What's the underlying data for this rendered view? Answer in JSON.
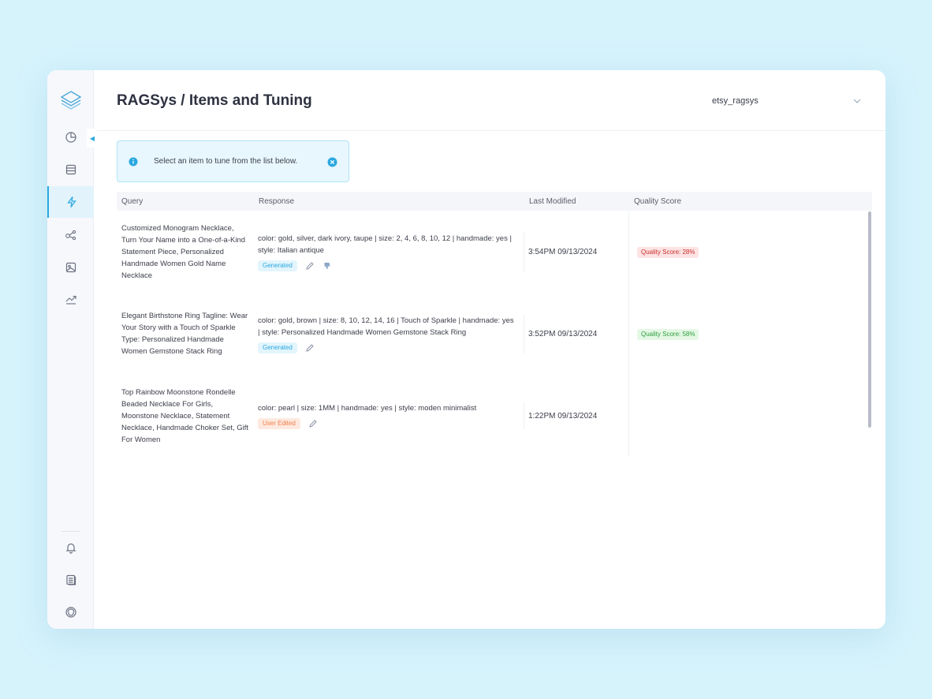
{
  "header": {
    "title": "RAGSys / Items and Tuning"
  },
  "workspace": {
    "selected": "etsy_ragsys"
  },
  "alert": {
    "text": "Select an item to tune from the list below."
  },
  "table": {
    "columns": [
      "Query",
      "Response",
      "Last Modified",
      "Quality Score"
    ],
    "rows": [
      {
        "query": "Customized Monogram Necklace, Turn Your Name into a One-of-a-Kind Statement Piece, Personalized Handmade Women Gold Name Necklace",
        "response": "color: gold, silver, dark ivory, taupe | size: 2, 4, 6, 8, 10, 12 | handmade: yes | style: Italian antique",
        "tag": "Generated",
        "modified": "3:54PM 09/13/2024",
        "score": "Quality Score: 28%"
      },
      {
        "query": "Elegant Birthstone Ring Tagline: Wear Your Story with a Touch of Sparkle Type: Personalized Handmade Women Gemstone Stack Ring",
        "response": "color: gold, brown | size:  8, 10, 12, 14, 16 | Touch of Sparkle | handmade: yes | style: Personalized Handmade Women Gemstone Stack Ring",
        "tag": "Generated",
        "modified": "3:52PM 09/13/2024",
        "score": "Quality Score: 58%"
      },
      {
        "query": "Top Rainbow Moonstone Rondelle Beaded Necklace For Girls, Moonstone Necklace, Statement Necklace, Handmade Choker Set, Gift For Women",
        "response": "color: pearl | size: 1MM | handmade: yes | style: moden minimalist",
        "tag": "User Edited",
        "modified": "1:22PM 09/13/2024",
        "score": ""
      }
    ]
  },
  "icons": {
    "logo": "layers-logo-icon",
    "nav": [
      "pie-chart-icon",
      "database-icon",
      "lightning-icon",
      "nodes-icon",
      "image-icon",
      "trend-icon"
    ],
    "bottom": [
      "bell-icon",
      "documents-icon",
      "support-icon"
    ]
  },
  "colors": {
    "accent": "#2aa8e0",
    "background": "#d6f3fc",
    "badge_low": "#c9302c",
    "badge_mid": "#2f9e3f",
    "tag_user": "#f27f4a"
  }
}
